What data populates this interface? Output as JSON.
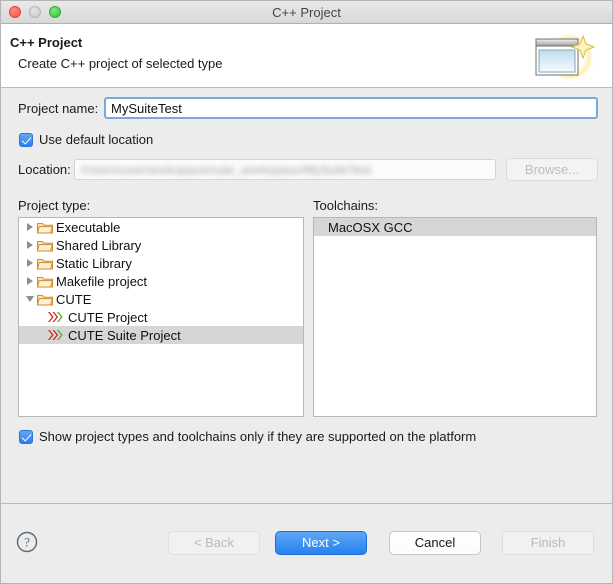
{
  "window": {
    "title": "C++ Project",
    "controls": {
      "close": "close-button",
      "minimize": "minimize-button",
      "zoom": "zoom-button"
    }
  },
  "header": {
    "title": "C++ Project",
    "subtitle": "Create C++ project of selected type",
    "icon": "new-project-wizard-icon"
  },
  "form": {
    "project_name_label": "Project name:",
    "project_name_value": "MySuiteTest",
    "project_name_placeholder": "",
    "use_default_location_label": "Use default location",
    "use_default_location_checked": true,
    "location_label": "Location:",
    "location_value": "/Users/user/workspace/cute_workspace/MySuiteTest",
    "location_enabled": false,
    "browse_label": "Browse...",
    "browse_enabled": false
  },
  "project_type": {
    "label": "Project type:",
    "items": [
      {
        "label": "Executable",
        "type": "folder",
        "expanded": false,
        "depth": 0,
        "selected": false
      },
      {
        "label": "Shared Library",
        "type": "folder",
        "expanded": false,
        "depth": 0,
        "selected": false
      },
      {
        "label": "Static Library",
        "type": "folder",
        "expanded": false,
        "depth": 0,
        "selected": false
      },
      {
        "label": "Makefile project",
        "type": "folder",
        "expanded": false,
        "depth": 0,
        "selected": false
      },
      {
        "label": "CUTE",
        "type": "folder",
        "expanded": true,
        "depth": 0,
        "selected": false
      },
      {
        "label": "CUTE Project",
        "type": "cute",
        "depth": 1,
        "selected": false
      },
      {
        "label": "CUTE Suite Project",
        "type": "cute",
        "depth": 1,
        "selected": true
      }
    ]
  },
  "toolchains": {
    "label": "Toolchains:",
    "items": [
      {
        "label": "MacOSX GCC",
        "selected": true
      }
    ]
  },
  "options": {
    "show_supported_label": "Show project types and toolchains only if they are supported on the platform",
    "show_supported_checked": true
  },
  "footer": {
    "help_icon": "help-icon",
    "back_label": "< Back",
    "back_enabled": false,
    "next_label": "Next >",
    "next_enabled": true,
    "cancel_label": "Cancel",
    "cancel_enabled": true,
    "finish_label": "Finish",
    "finish_enabled": false
  },
  "colors": {
    "accent": "#2681ef",
    "selection": "#d6d6d6",
    "dialog_bg": "#ececec",
    "folder": "#e8a33d",
    "cute_red": "#cc2222",
    "cute_green": "#4caf22"
  }
}
